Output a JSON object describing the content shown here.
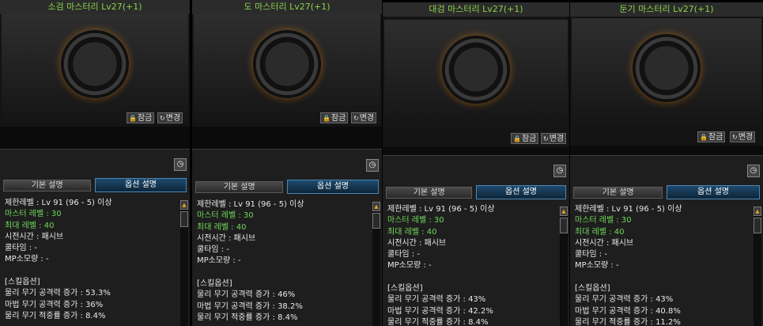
{
  "panels": [
    {
      "title": "소검 마스터리 Lv27(+1)",
      "lock": "잠금",
      "change": "변경",
      "tab_basic": "기본 설명",
      "tab_option": "옵션 설명",
      "lines": {
        "req_level": "제한레벨 : Lv 91 (96 - 5) 이상",
        "master_level": "마스터 레벨 : 30",
        "max_level": "최대 레벨 : 40",
        "cast_time": "시전시간 : 패시브",
        "cooldown": "쿨타임 : -",
        "mp_cost": "MP소모량 : -",
        "skill_option_header": "[스킬옵션]",
        "phys_atk": "물리 무기 공격력 증가 : 53.3%",
        "mag_atk": "마법 무기 공격력 증가 : 36%",
        "hit_rate": "물리 무기 적중률 증가 : 8.4%"
      }
    },
    {
      "title": "도 마스터리 Lv27(+1)",
      "lock": "잠금",
      "change": "변경",
      "tab_basic": "기본 설명",
      "tab_option": "옵션 설명",
      "lines": {
        "req_level": "제한레벨 : Lv 91 (96 - 5) 이상",
        "master_level": "마스터 레벨 : 30",
        "max_level": "최대 레벨 : 40",
        "cast_time": "시전시간 : 패시브",
        "cooldown": "쿨타임 : -",
        "mp_cost": "MP소모량 : -",
        "skill_option_header": "[스킬옵션]",
        "phys_atk": "물리 무기 공격력 증가 : 46%",
        "mag_atk": "마법 무기 공격력 증가 : 38.2%",
        "hit_rate": "물리 무기 적중률 증가 : 8.4%"
      }
    },
    {
      "title": "대검 마스터리 Lv27(+1)",
      "lock": "잠금",
      "change": "변경",
      "tab_basic": "기본 설명",
      "tab_option": "옵션 설명",
      "lines": {
        "req_level": "제한레벨 : Lv 91 (96 - 5) 이상",
        "master_level": "마스터 레벨 : 30",
        "max_level": "최대 레벨 : 40",
        "cast_time": "시전시간 : 패시브",
        "cooldown": "쿨타임 : -",
        "mp_cost": "MP소모량 : -",
        "skill_option_header": "[스킬옵션]",
        "phys_atk": "물리 무기 공격력 증가 : 43%",
        "mag_atk": "마법 무기 공격력 증가 : 42.2%",
        "hit_rate": "물리 무기 적중률 증가 : 8.4%"
      }
    },
    {
      "title": "둔기 마스터리 Lv27(+1)",
      "lock": "잠금",
      "change": "변경",
      "tab_basic": "기본 설명",
      "tab_option": "옵션 설명",
      "lines": {
        "req_level": "제한레벨 : Lv 91 (96 - 5) 이상",
        "master_level": "마스터 레벨 : 30",
        "max_level": "최대 레벨 : 40",
        "cast_time": "시전시간 : 패시브",
        "cooldown": "쿨타임 : -",
        "mp_cost": "MP소모량 : -",
        "skill_option_header": "[스킬옵션]",
        "phys_atk": "물리 무기 공격력 증가 : 43%",
        "mag_atk": "마법 무기 공격력 증가 : 40.8%",
        "hit_rate": "물리 무기 적중률 증가 : 11.2%"
      }
    }
  ],
  "colors": {
    "title_green": "#8ad24a",
    "stat_green": "#6fd85a",
    "tab_active": "#1d4a6d"
  }
}
